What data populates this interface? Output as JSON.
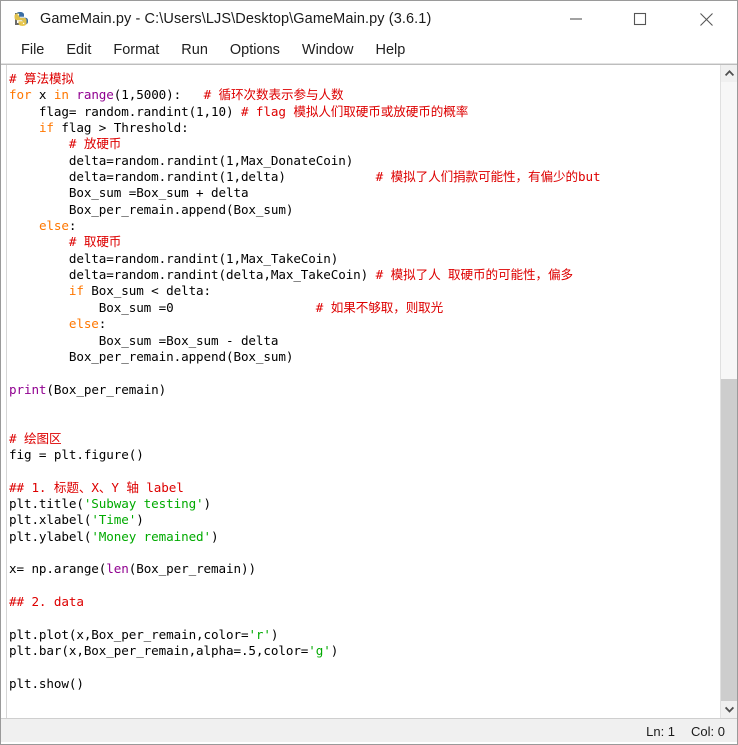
{
  "window": {
    "title": "GameMain.py - C:\\Users\\LJS\\Desktop\\GameMain.py (3.6.1)",
    "icon": "python-idle-icon",
    "controls": {
      "minimize": "minimize-icon",
      "maximize": "maximize-icon",
      "close": "close-icon"
    }
  },
  "menubar": {
    "items": [
      {
        "label": "File"
      },
      {
        "label": "Edit"
      },
      {
        "label": "Format"
      },
      {
        "label": "Run"
      },
      {
        "label": "Options"
      },
      {
        "label": "Window"
      },
      {
        "label": "Help"
      }
    ]
  },
  "editor": {
    "lines": [
      [
        {
          "t": "# 算法模拟",
          "c": "cmt"
        }
      ],
      [
        {
          "t": "for",
          "c": "kw"
        },
        {
          "t": " x ",
          "c": "def"
        },
        {
          "t": "in",
          "c": "kw"
        },
        {
          "t": " ",
          "c": "def"
        },
        {
          "t": "range",
          "c": "bi"
        },
        {
          "t": "(1,5000):   ",
          "c": "def"
        },
        {
          "t": "# 循环次数表示参与人数",
          "c": "cmt"
        }
      ],
      [
        {
          "t": "    flag= random.randint(1,10) ",
          "c": "def"
        },
        {
          "t": "# flag 模拟人们取硬币或放硬币的概率",
          "c": "cmt"
        }
      ],
      [
        {
          "t": "    ",
          "c": "def"
        },
        {
          "t": "if",
          "c": "kw"
        },
        {
          "t": " flag > Threshold:",
          "c": "def"
        }
      ],
      [
        {
          "t": "        ",
          "c": "def"
        },
        {
          "t": "# 放硬币",
          "c": "cmt"
        }
      ],
      [
        {
          "t": "        delta=random.randint(1,Max_DonateCoin)",
          "c": "def"
        }
      ],
      [
        {
          "t": "        delta=random.randint(1,delta)            ",
          "c": "def"
        },
        {
          "t": "# 模拟了人们捐款可能性，有偏少的but",
          "c": "cmt"
        }
      ],
      [
        {
          "t": "        Box_sum =Box_sum + delta",
          "c": "def"
        }
      ],
      [
        {
          "t": "        Box_per_remain.append(Box_sum)",
          "c": "def"
        }
      ],
      [
        {
          "t": "    ",
          "c": "def"
        },
        {
          "t": "else",
          "c": "kw"
        },
        {
          "t": ":",
          "c": "def"
        }
      ],
      [
        {
          "t": "        ",
          "c": "def"
        },
        {
          "t": "# 取硬币",
          "c": "cmt"
        }
      ],
      [
        {
          "t": "        delta=random.randint(1,Max_TakeCoin)",
          "c": "def"
        }
      ],
      [
        {
          "t": "        delta=random.randint(delta,Max_TakeCoin) ",
          "c": "def"
        },
        {
          "t": "# 模拟了人 取硬币的可能性，偏多",
          "c": "cmt"
        }
      ],
      [
        {
          "t": "        ",
          "c": "def"
        },
        {
          "t": "if",
          "c": "kw"
        },
        {
          "t": " Box_sum < delta:",
          "c": "def"
        }
      ],
      [
        {
          "t": "            Box_sum =0                   ",
          "c": "def"
        },
        {
          "t": "# 如果不够取，则取光",
          "c": "cmt"
        }
      ],
      [
        {
          "t": "        ",
          "c": "def"
        },
        {
          "t": "else",
          "c": "kw"
        },
        {
          "t": ":",
          "c": "def"
        }
      ],
      [
        {
          "t": "            Box_sum =Box_sum - delta",
          "c": "def"
        }
      ],
      [
        {
          "t": "        Box_per_remain.append(Box_sum)",
          "c": "def"
        }
      ],
      [
        {
          "t": "",
          "c": "def"
        }
      ],
      [
        {
          "t": "print",
          "c": "bi"
        },
        {
          "t": "(Box_per_remain)",
          "c": "def"
        }
      ],
      [
        {
          "t": "",
          "c": "def"
        }
      ],
      [
        {
          "t": "",
          "c": "def"
        }
      ],
      [
        {
          "t": "# 绘图区",
          "c": "cmt"
        }
      ],
      [
        {
          "t": "fig = plt.figure()",
          "c": "def"
        }
      ],
      [
        {
          "t": "",
          "c": "def"
        }
      ],
      [
        {
          "t": "## 1. 标题、X、Y 轴 label",
          "c": "cmt"
        }
      ],
      [
        {
          "t": "plt.title(",
          "c": "def"
        },
        {
          "t": "'Subway testing'",
          "c": "str"
        },
        {
          "t": ")",
          "c": "def"
        }
      ],
      [
        {
          "t": "plt.xlabel(",
          "c": "def"
        },
        {
          "t": "'Time'",
          "c": "str"
        },
        {
          "t": ")",
          "c": "def"
        }
      ],
      [
        {
          "t": "plt.ylabel(",
          "c": "def"
        },
        {
          "t": "'Money remained'",
          "c": "str"
        },
        {
          "t": ")",
          "c": "def"
        }
      ],
      [
        {
          "t": "",
          "c": "def"
        }
      ],
      [
        {
          "t": "x= np.arange(",
          "c": "def"
        },
        {
          "t": "len",
          "c": "bi"
        },
        {
          "t": "(Box_per_remain))",
          "c": "def"
        }
      ],
      [
        {
          "t": "",
          "c": "def"
        }
      ],
      [
        {
          "t": "## 2. data",
          "c": "cmt"
        }
      ],
      [
        {
          "t": "",
          "c": "def"
        }
      ],
      [
        {
          "t": "plt.plot(x,Box_per_remain,color=",
          "c": "def"
        },
        {
          "t": "'r'",
          "c": "str"
        },
        {
          "t": ")",
          "c": "def"
        }
      ],
      [
        {
          "t": "plt.bar(x,Box_per_remain,alpha=.5,color=",
          "c": "def"
        },
        {
          "t": "'g'",
          "c": "str"
        },
        {
          "t": ")",
          "c": "def"
        }
      ],
      [
        {
          "t": "",
          "c": "def"
        }
      ],
      [
        {
          "t": "plt.show()",
          "c": "def"
        }
      ]
    ]
  },
  "scrollbar": {
    "up_arrow": "chevron-up-icon",
    "down_arrow": "chevron-down-icon",
    "thumb": "scroll-thumb"
  },
  "statusbar": {
    "line": "Ln: 1",
    "column": "Col: 0"
  },
  "colors": {
    "keyword": "#ff7700",
    "builtin": "#900090",
    "string": "#00aa00",
    "comment": "#dd0000",
    "text": "#000000",
    "accent": "#2a6ebb"
  }
}
